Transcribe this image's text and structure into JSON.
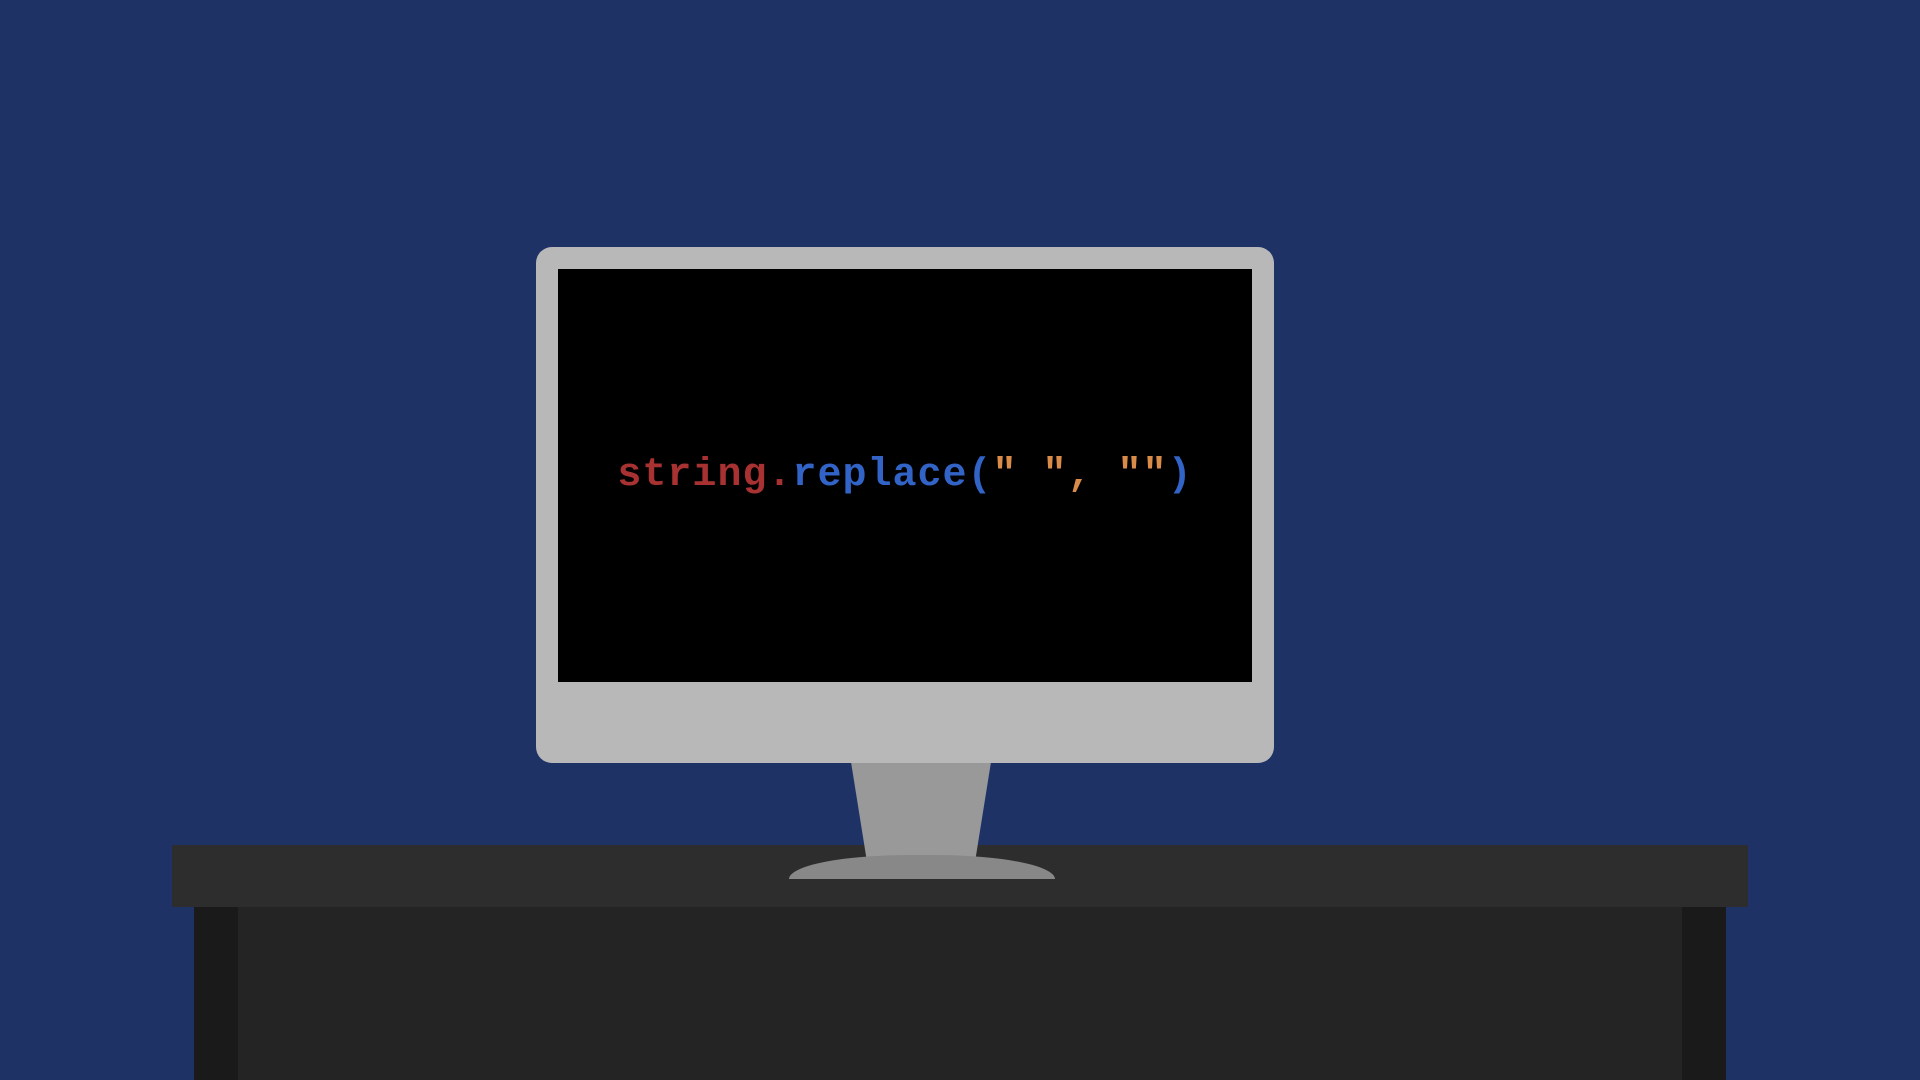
{
  "colors": {
    "background": "#1e3266",
    "deskTop": "#2d2d2d",
    "deskLeg": "#1a1a1a",
    "deskShelf": "#242424",
    "monitorBase": "#888888",
    "monitorStand": "#999999",
    "monitorBody": "#b8b8b8",
    "screen": "#000000"
  },
  "code": {
    "variable": "string",
    "dot": ".",
    "method": "replace",
    "openParen": "(",
    "arg1": "\" \"",
    "comma": ", ",
    "arg2": "\"\"",
    "closeParen": ")"
  }
}
